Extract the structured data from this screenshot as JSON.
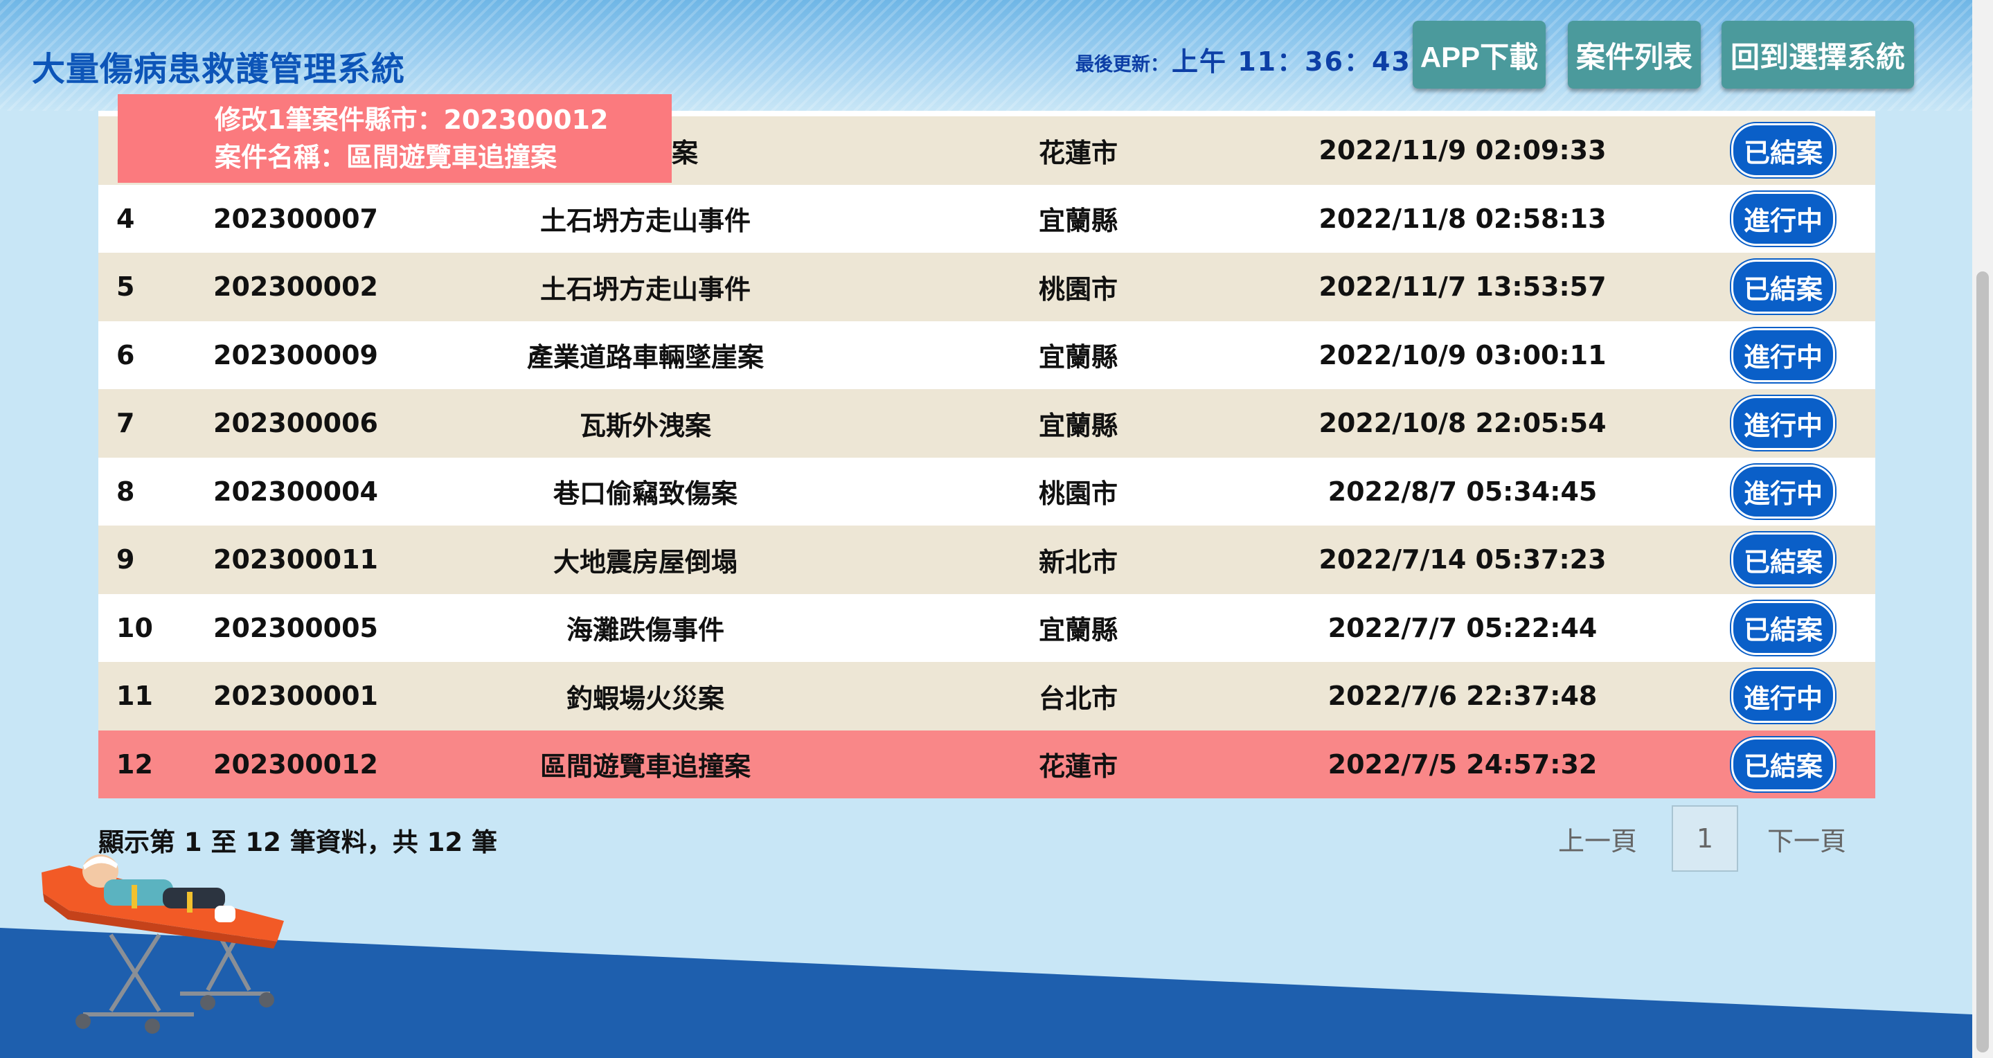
{
  "header": {
    "title": "大量傷病患救護管理系統",
    "last_update_label": "最後更新：",
    "last_update_time": "上午 11：36：43",
    "buttons": {
      "app_download": "APP下載",
      "case_list": "案件列表",
      "back_to_select": "回到選擇系統"
    }
  },
  "toast": {
    "line1": "修改1筆案件縣市：202300012",
    "line2": "案件名稱：區間遊覽車追撞案"
  },
  "table": {
    "rows": [
      {
        "idx": "",
        "case_id": "",
        "name": "山硫磺案",
        "city": "花蓮市",
        "time": "2022/11/9 02:09:33",
        "status": "已結案",
        "highlight": false
      },
      {
        "idx": "4",
        "case_id": "202300007",
        "name": "土石坍方走山事件",
        "city": "宜蘭縣",
        "time": "2022/11/8 02:58:13",
        "status": "進行中",
        "highlight": false
      },
      {
        "idx": "5",
        "case_id": "202300002",
        "name": "土石坍方走山事件",
        "city": "桃園市",
        "time": "2022/11/7 13:53:57",
        "status": "已結案",
        "highlight": false
      },
      {
        "idx": "6",
        "case_id": "202300009",
        "name": "產業道路車輛墜崖案",
        "city": "宜蘭縣",
        "time": "2022/10/9 03:00:11",
        "status": "進行中",
        "highlight": false
      },
      {
        "idx": "7",
        "case_id": "202300006",
        "name": "瓦斯外洩案",
        "city": "宜蘭縣",
        "time": "2022/10/8 22:05:54",
        "status": "進行中",
        "highlight": false
      },
      {
        "idx": "8",
        "case_id": "202300004",
        "name": "巷口偷竊致傷案",
        "city": "桃園市",
        "time": "2022/8/7 05:34:45",
        "status": "進行中",
        "highlight": false
      },
      {
        "idx": "9",
        "case_id": "202300011",
        "name": "大地震房屋倒塌",
        "city": "新北市",
        "time": "2022/7/14 05:37:23",
        "status": "已結案",
        "highlight": false
      },
      {
        "idx": "10",
        "case_id": "202300005",
        "name": "海灘跌傷事件",
        "city": "宜蘭縣",
        "time": "2022/7/7 05:22:44",
        "status": "已結案",
        "highlight": false
      },
      {
        "idx": "11",
        "case_id": "202300001",
        "name": "釣蝦場火災案",
        "city": "台北市",
        "time": "2022/7/6 22:37:48",
        "status": "進行中",
        "highlight": false
      },
      {
        "idx": "12",
        "case_id": "202300012",
        "name": "區間遊覽車追撞案",
        "city": "花蓮市",
        "time": "2022/7/5 24:57:32",
        "status": "已結案",
        "highlight": true
      }
    ]
  },
  "footer": {
    "info": "顯示第 1 至 12 筆資料，共 12 筆",
    "prev": "上一頁",
    "page": "1",
    "next": "下一頁"
  },
  "colors": {
    "row_odd": "#ede6d5",
    "row_even": "#ffffff",
    "row_highlight": "#f98788",
    "status_button": "#0a5fc8",
    "header_button": "#4b9a9c",
    "toast": "#fb7a7e",
    "wave": "#1e5fae"
  }
}
